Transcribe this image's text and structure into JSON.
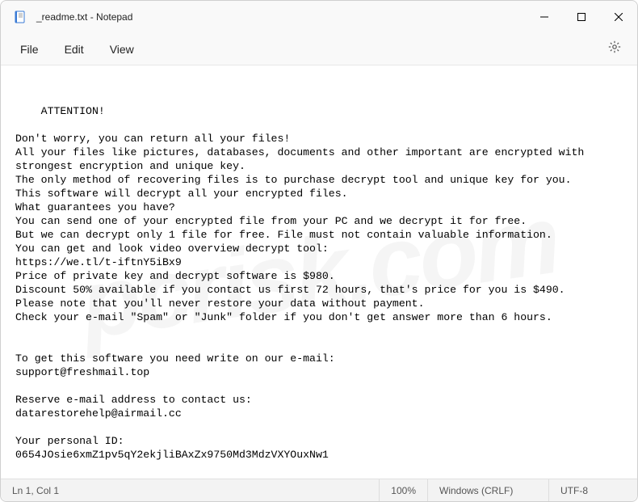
{
  "titlebar": {
    "title": "_readme.txt - Notepad"
  },
  "menubar": {
    "file": "File",
    "edit": "Edit",
    "view": "View"
  },
  "content": {
    "text": "ATTENTION!\n\nDon't worry, you can return all your files!\nAll your files like pictures, databases, documents and other important are encrypted with strongest encryption and unique key.\nThe only method of recovering files is to purchase decrypt tool and unique key for you.\nThis software will decrypt all your encrypted files.\nWhat guarantees you have?\nYou can send one of your encrypted file from your PC and we decrypt it for free.\nBut we can decrypt only 1 file for free. File must not contain valuable information.\nYou can get and look video overview decrypt tool:\nhttps://we.tl/t-iftnY5iBx9\nPrice of private key and decrypt software is $980.\nDiscount 50% available if you contact us first 72 hours, that's price for you is $490.\nPlease note that you'll never restore your data without payment.\nCheck your e-mail \"Spam\" or \"Junk\" folder if you don't get answer more than 6 hours.\n\n\nTo get this software you need write on our e-mail:\nsupport@freshmail.top\n\nReserve e-mail address to contact us:\ndatarestorehelp@airmail.cc\n\nYour personal ID:\n0654JOsie6xmZ1pv5qY2ekjliBAxZx9750Md3MdzVXYOuxNw1"
  },
  "statusbar": {
    "position": "Ln 1, Col 1",
    "zoom": "100%",
    "line_ending": "Windows (CRLF)",
    "encoding": "UTF-8"
  },
  "watermark": "pcrisk.com"
}
